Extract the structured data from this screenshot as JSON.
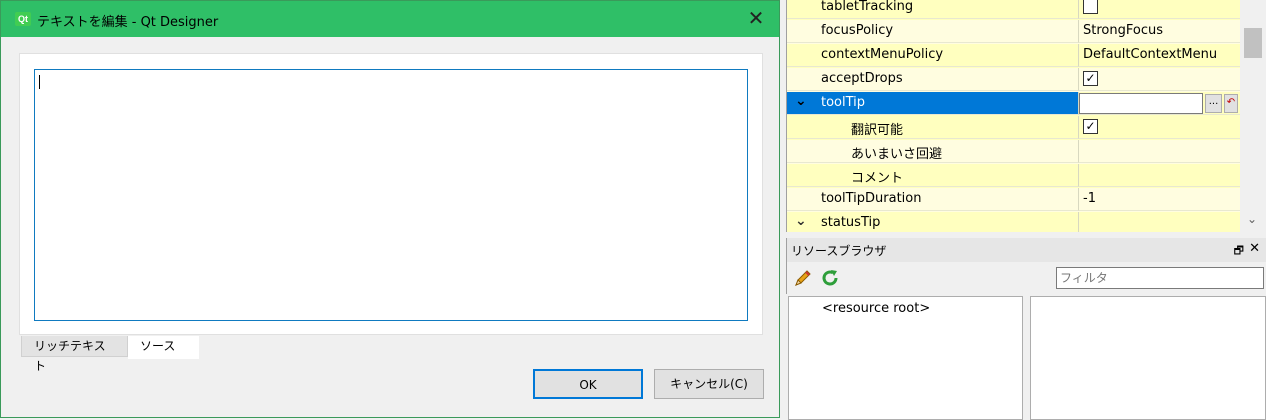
{
  "dialog": {
    "title": "テキストを編集 - Qt Designer",
    "app_icon_text": "Qt",
    "close_glyph": "✕",
    "tabs": [
      {
        "label": "リッチテキスト"
      },
      {
        "label": "ソース"
      }
    ],
    "ok_label": "OK",
    "cancel_label": "キャンセル(C)"
  },
  "property_editor": {
    "rows": [
      {
        "name": "tabletTracking",
        "value": ""
      },
      {
        "name": "focusPolicy",
        "value": "StrongFocus"
      },
      {
        "name": "contextMenuPolicy",
        "value": "DefaultContextMenu"
      },
      {
        "name": "acceptDrops",
        "value": "✓"
      },
      {
        "name": "toolTip",
        "value": ""
      },
      {
        "name": "翻訳可能",
        "value": "✓"
      },
      {
        "name": "あいまいさ回避",
        "value": ""
      },
      {
        "name": "コメント",
        "value": ""
      },
      {
        "name": "toolTipDuration",
        "value": "-1"
      },
      {
        "name": "statusTip",
        "value": ""
      }
    ],
    "expand_glyph": "⌄",
    "more_button_label": "...",
    "reset_glyph": "↶",
    "scroll_down_glyph": "⌄",
    "selected_color": "#0078d7",
    "row_color": "#ffffbf"
  },
  "resource_browser": {
    "title": "リソースブラウザ",
    "float_glyph": "🗗",
    "close_glyph": "✕",
    "filter_placeholder": "フィルタ",
    "root_item": "<resource root>"
  }
}
